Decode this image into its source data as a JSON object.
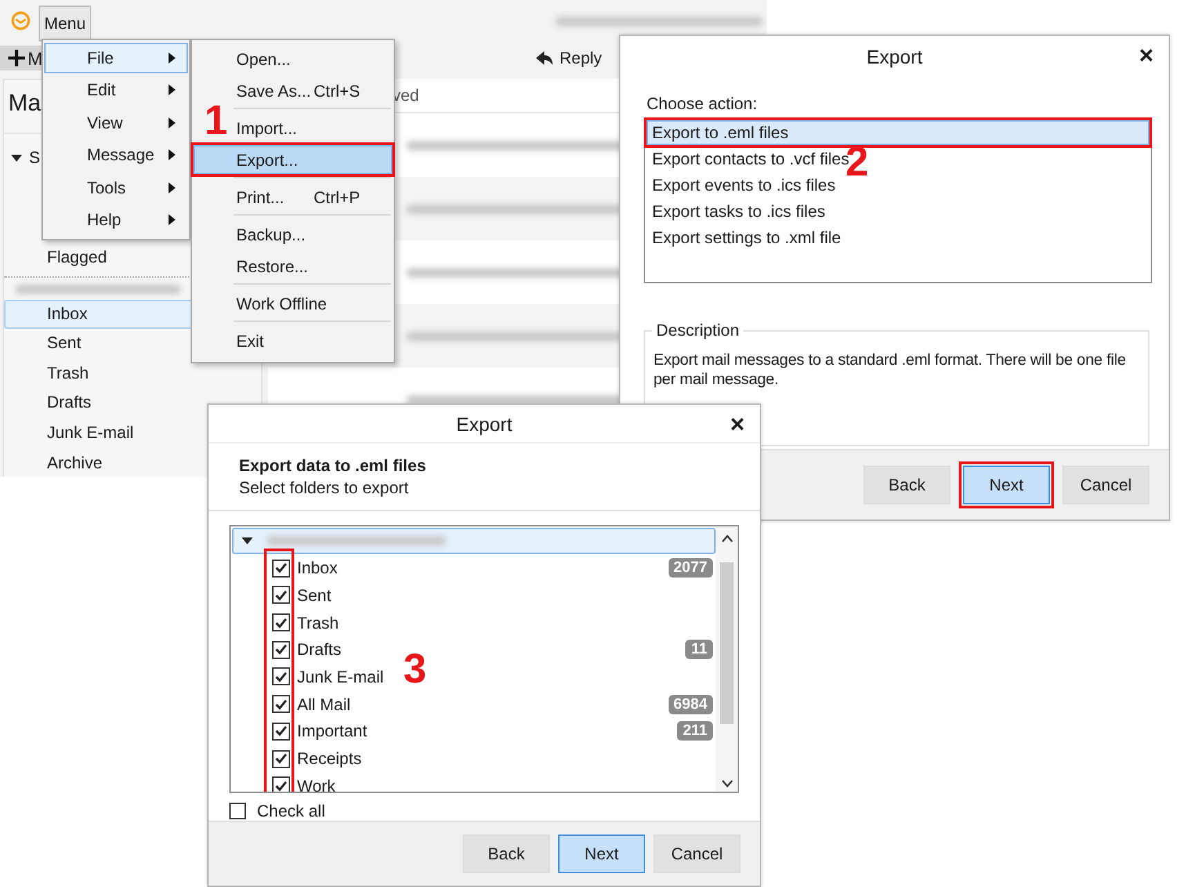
{
  "app": {
    "menu_button": "Menu",
    "new_button": "M",
    "reply_button": "Reply",
    "panel_title": "Ma",
    "column_fragment": "ved",
    "group_label": "S",
    "group_expanded": true,
    "favorites": [
      {
        "label": "Flagged",
        "selected": false
      }
    ],
    "folders": [
      {
        "label": "Inbox",
        "selected": true
      },
      {
        "label": "Sent",
        "selected": false
      },
      {
        "label": "Trash",
        "selected": false
      },
      {
        "label": "Drafts",
        "selected": false
      },
      {
        "label": "Junk E-mail",
        "selected": false
      },
      {
        "label": "Archive",
        "selected": false
      }
    ]
  },
  "menu": {
    "items": [
      {
        "label": "File",
        "selected": true
      },
      {
        "label": "Edit",
        "selected": false
      },
      {
        "label": "View",
        "selected": false
      },
      {
        "label": "Message",
        "selected": false
      },
      {
        "label": "Tools",
        "selected": false
      },
      {
        "label": "Help",
        "selected": false
      }
    ]
  },
  "submenu": {
    "items": [
      {
        "kind": "item",
        "label": "Open...",
        "selected": false,
        "annotated": false
      },
      {
        "kind": "item",
        "label": "Save As...",
        "shortcut": "Ctrl+S",
        "selected": false,
        "annotated": false
      },
      {
        "kind": "separator"
      },
      {
        "kind": "item",
        "label": "Import...",
        "selected": false,
        "annotated": false
      },
      {
        "kind": "item",
        "label": "Export...",
        "selected": true,
        "annotated": true
      },
      {
        "kind": "separator"
      },
      {
        "kind": "item",
        "label": "Print...",
        "shortcut": "Ctrl+P",
        "selected": false,
        "annotated": false
      },
      {
        "kind": "separator"
      },
      {
        "kind": "item",
        "label": "Backup...",
        "selected": false,
        "annotated": false
      },
      {
        "kind": "item",
        "label": "Restore...",
        "selected": false,
        "annotated": false
      },
      {
        "kind": "separator"
      },
      {
        "kind": "item",
        "label": "Work Offline",
        "selected": false,
        "annotated": false
      },
      {
        "kind": "separator"
      },
      {
        "kind": "item",
        "label": "Exit",
        "selected": false,
        "annotated": false
      }
    ]
  },
  "steps": [
    "1",
    "2",
    "3"
  ],
  "export_dialog": {
    "title": "Export",
    "close": "×",
    "prompt": "Choose action:",
    "actions": [
      {
        "label": "Export to .eml files",
        "selected": true,
        "annotated": true
      },
      {
        "label": "Export contacts to .vcf files",
        "selected": false,
        "annotated": false
      },
      {
        "label": "Export events to .ics files",
        "selected": false,
        "annotated": false
      },
      {
        "label": "Export tasks to .ics files",
        "selected": false,
        "annotated": false
      },
      {
        "label": "Export settings to .xml file",
        "selected": false,
        "annotated": false
      }
    ],
    "description_title": "Description",
    "description": "Export mail messages to a standard .eml format. There will be one file per mail message.",
    "buttons": [
      {
        "label": "Back",
        "primary": false,
        "annotated": false
      },
      {
        "label": "Next",
        "primary": true,
        "annotated": true
      },
      {
        "label": "Cancel",
        "primary": false,
        "annotated": false
      }
    ]
  },
  "folders_dialog": {
    "title": "Export",
    "close": "×",
    "heading": "Export data to .eml files",
    "subheading": "Select folders to export",
    "account_expanded": true,
    "highlight_checkboxes": true,
    "folders": [
      {
        "label": "Inbox",
        "checked": true,
        "count": "2077"
      },
      {
        "label": "Sent",
        "checked": true
      },
      {
        "label": "Trash",
        "checked": true
      },
      {
        "label": "Drafts",
        "checked": true,
        "count": "11"
      },
      {
        "label": "Junk E-mail",
        "checked": true
      },
      {
        "label": "All Mail",
        "checked": true,
        "count": "6984"
      },
      {
        "label": "Important",
        "checked": true,
        "count": "211"
      },
      {
        "label": "Receipts",
        "checked": true
      },
      {
        "label": "Work",
        "checked": true
      }
    ],
    "check_all": {
      "label": "Check all",
      "checked": false
    },
    "buttons": [
      {
        "label": "Back",
        "primary": false,
        "annotated": false
      },
      {
        "label": "Next",
        "primary": true,
        "annotated": false
      },
      {
        "label": "Cancel",
        "primary": false,
        "annotated": false
      }
    ]
  }
}
